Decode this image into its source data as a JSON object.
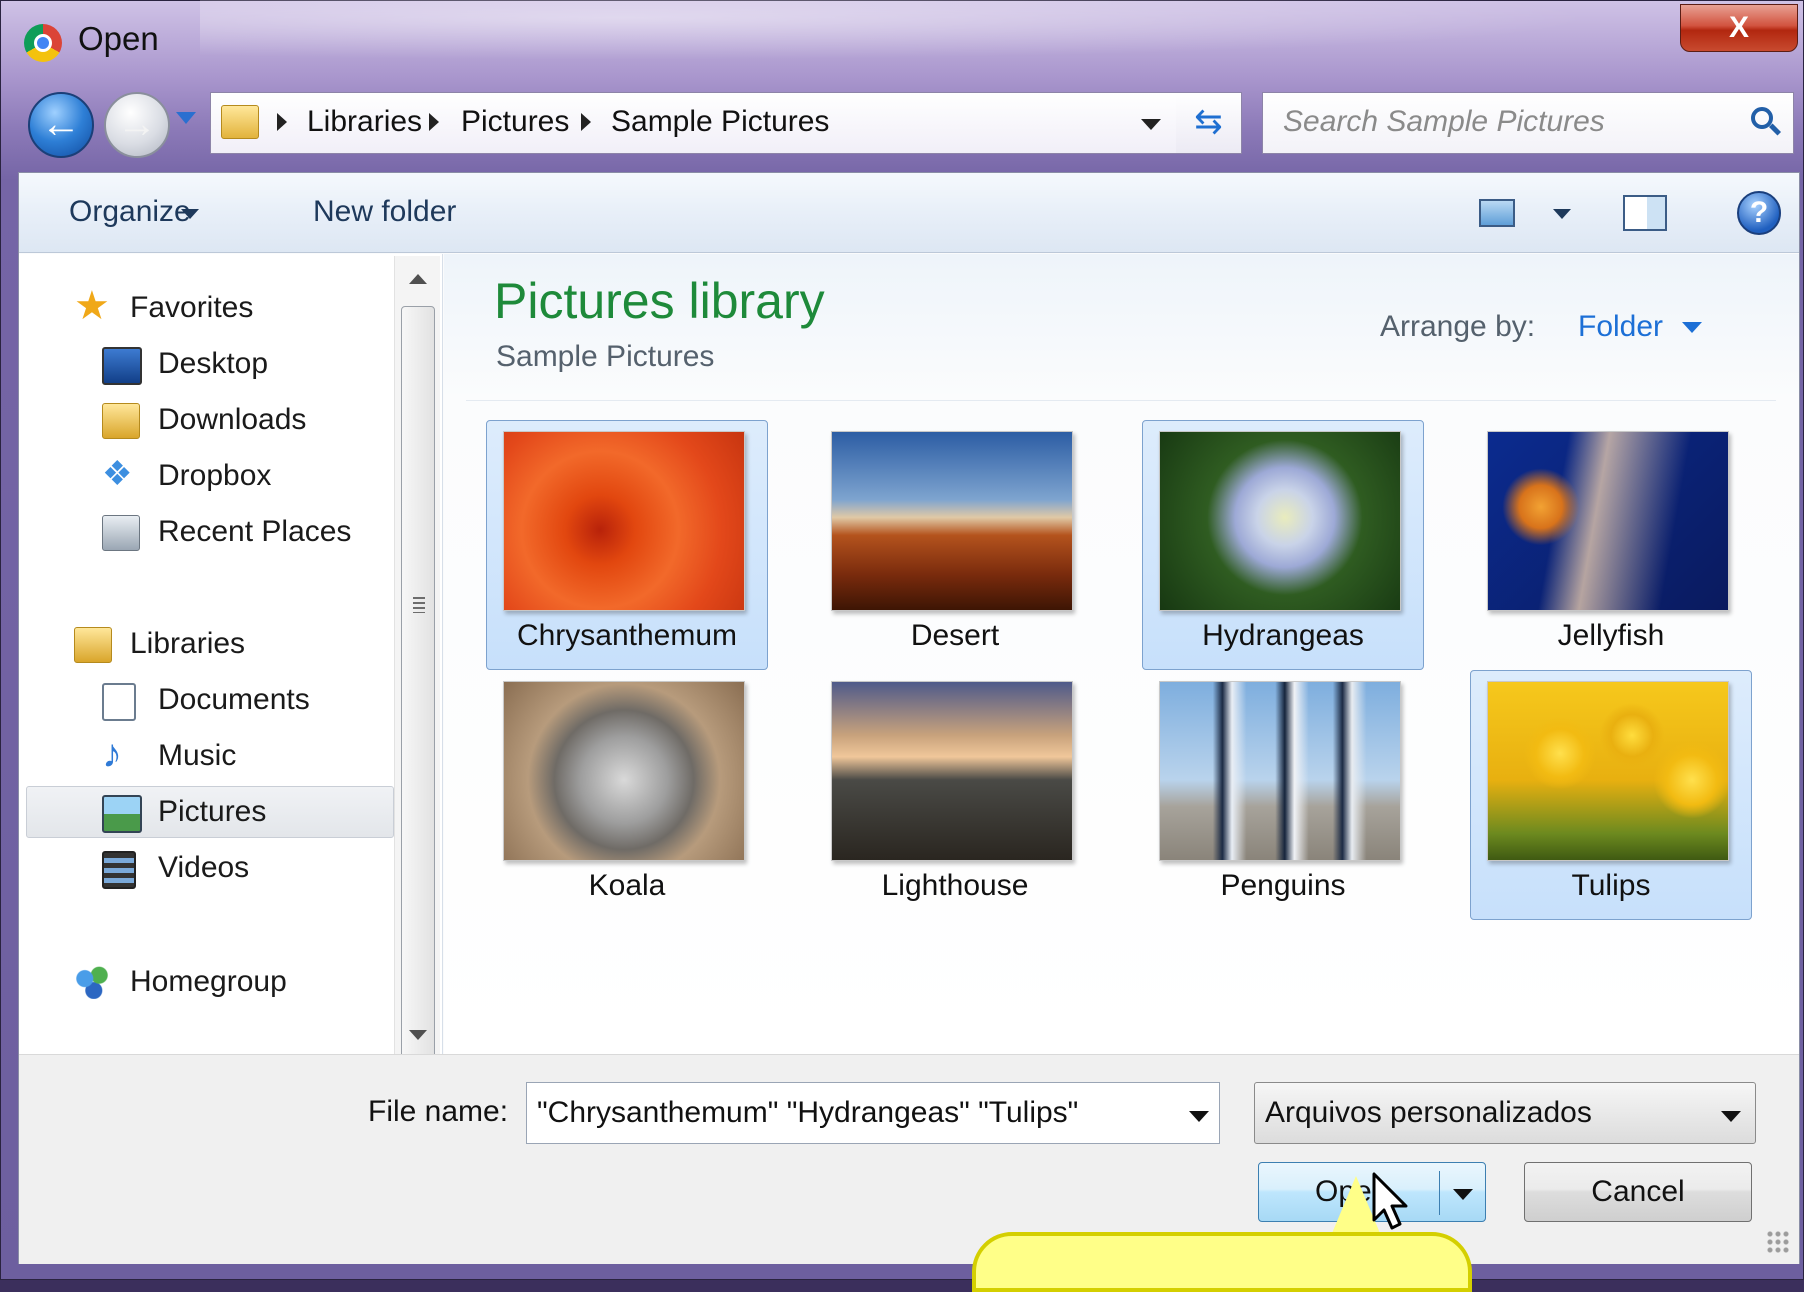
{
  "window": {
    "title": "Open",
    "close_label": "X"
  },
  "nav": {
    "back_glyph": "←",
    "forward_glyph": "→"
  },
  "address_bar": {
    "crumbs": [
      "Libraries",
      "Pictures",
      "Sample Pictures"
    ]
  },
  "search": {
    "placeholder": "Search Sample Pictures"
  },
  "toolbar": {
    "organize": "Organize",
    "new_folder": "New folder",
    "help": "?"
  },
  "sidebar": {
    "favorites_header": "Favorites",
    "favorites": [
      "Desktop",
      "Downloads",
      "Dropbox",
      "Recent Places"
    ],
    "libraries_header": "Libraries",
    "libraries": [
      "Documents",
      "Music",
      "Pictures",
      "Videos"
    ],
    "selected": "Pictures",
    "homegroup": "Homegroup"
  },
  "content": {
    "title": "Pictures library",
    "subtitle": "Sample Pictures",
    "arrange_label": "Arrange by:",
    "arrange_value": "Folder",
    "files": [
      {
        "name": "Chrysanthemum",
        "selected": true
      },
      {
        "name": "Desert",
        "selected": false
      },
      {
        "name": "Hydrangeas",
        "selected": true
      },
      {
        "name": "Jellyfish",
        "selected": false
      },
      {
        "name": "Koala",
        "selected": false
      },
      {
        "name": "Lighthouse",
        "selected": false
      },
      {
        "name": "Penguins",
        "selected": false
      },
      {
        "name": "Tulips",
        "selected": true
      }
    ]
  },
  "footer": {
    "file_name_label": "File name:",
    "file_name_value": "\"Chrysanthemum\" \"Hydrangeas\" \"Tulips\"",
    "file_type": "Arquivos personalizados",
    "open_label": "Open",
    "cancel_label": "Cancel"
  },
  "colors": {
    "library_title": "#1e8a3a",
    "link": "#1c6fd6",
    "selection": "#c7e0fb"
  }
}
